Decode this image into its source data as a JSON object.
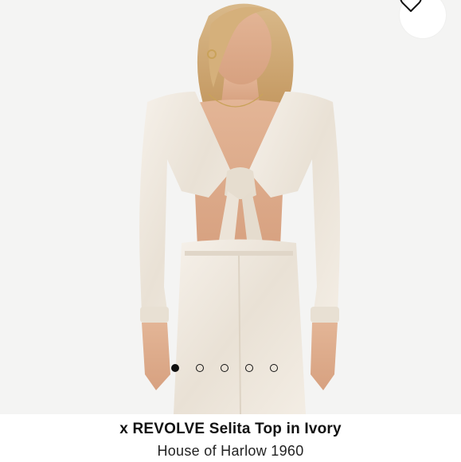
{
  "product": {
    "title": "x REVOLVE Selita Top in Ivory",
    "brand": "House of Harlow 1960"
  },
  "gallery": {
    "image_alt": "Model wearing ivory satin tie-front crop top and matching pants",
    "total_images": 5,
    "active_index": 0
  },
  "icons": {
    "wishlist": "heart-outline-icon"
  },
  "colors": {
    "background": "#f4f4f3",
    "garment": "#efe9e0",
    "dot_active": "#111111"
  }
}
